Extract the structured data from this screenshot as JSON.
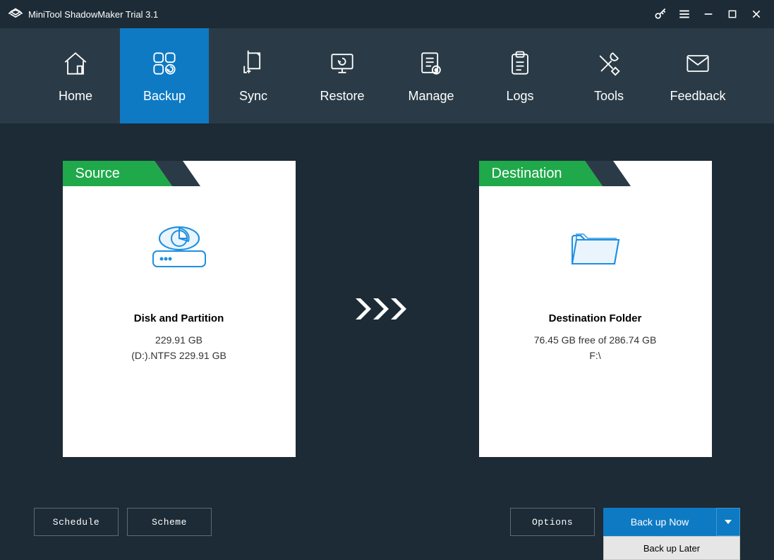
{
  "app": {
    "title": "MiniTool ShadowMaker Trial 3.1"
  },
  "nav": {
    "items": [
      {
        "label": "Home"
      },
      {
        "label": "Backup"
      },
      {
        "label": "Sync"
      },
      {
        "label": "Restore"
      },
      {
        "label": "Manage"
      },
      {
        "label": "Logs"
      },
      {
        "label": "Tools"
      },
      {
        "label": "Feedback"
      }
    ]
  },
  "source": {
    "header": "Source",
    "title": "Disk and Partition",
    "size": "229.91 GB",
    "detail": "(D:).NTFS 229.91 GB"
  },
  "destination": {
    "header": "Destination",
    "title": "Destination Folder",
    "free": "76.45 GB free of 286.74 GB",
    "path": "F:\\"
  },
  "buttons": {
    "schedule": "Schedule",
    "scheme": "Scheme",
    "options": "Options",
    "backup_now": "Back up Now",
    "backup_later": "Back up Later"
  }
}
